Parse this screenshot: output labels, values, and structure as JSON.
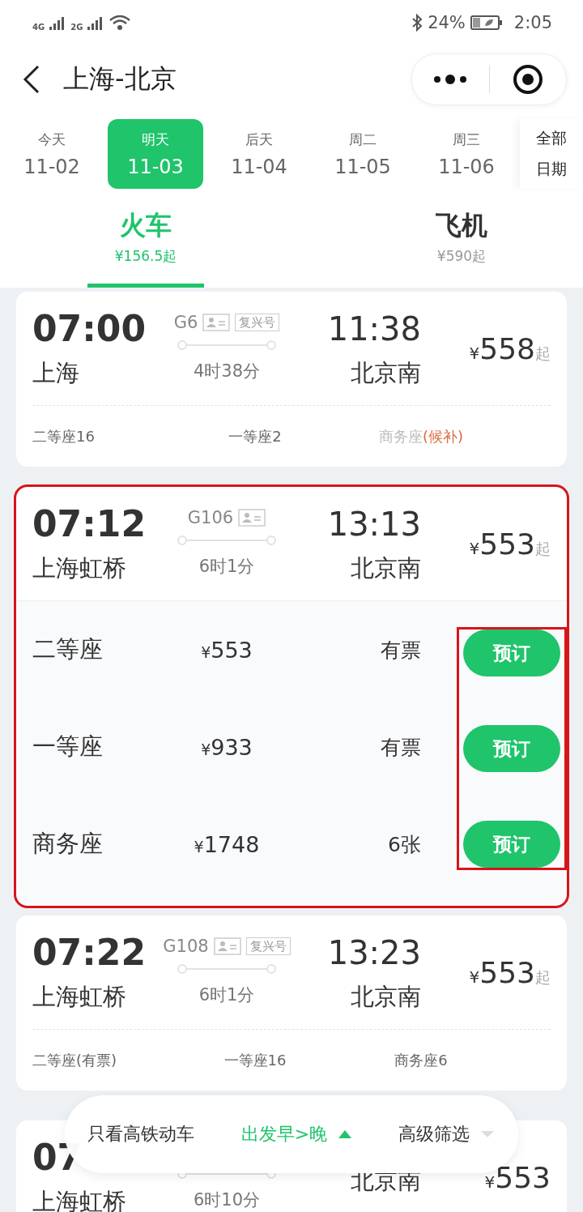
{
  "status_bar": {
    "network_1": "4G",
    "network_2": "2G",
    "battery": "24%",
    "time": "2:05"
  },
  "header": {
    "title": "上海-北京"
  },
  "dates": [
    {
      "weekday": "今天",
      "date": "11-02",
      "selected": false
    },
    {
      "weekday": "明天",
      "date": "11-03",
      "selected": true
    },
    {
      "weekday": "后天",
      "date": "11-04",
      "selected": false
    },
    {
      "weekday": "周二",
      "date": "11-05",
      "selected": false
    },
    {
      "weekday": "周三",
      "date": "11-06",
      "selected": false
    }
  ],
  "all_dates": {
    "line_1": "全部",
    "line_2": "日期"
  },
  "mode_tabs": [
    {
      "label": "火车",
      "price": "¥156.5起",
      "selected": true
    },
    {
      "label": "飞机",
      "price": "¥590起",
      "selected": false
    }
  ],
  "trains": [
    {
      "departure": "07:00",
      "from": "上海",
      "train_no": "G6",
      "type_tag": "复兴号",
      "duration": "4时38分",
      "arrival": "11:38",
      "to": "北京南",
      "currency": "¥",
      "price": "558",
      "suffix": "起",
      "kind": "collapsed",
      "annotated": false,
      "seats": [
        {
          "name": "二等座",
          "status": "16",
          "available": true
        },
        {
          "name": "一等座",
          "status": "2",
          "available": true
        },
        {
          "name": "商务座",
          "status": "(候补)",
          "available": false
        }
      ]
    },
    {
      "departure": "07:12",
      "from": "上海虹桥",
      "train_no": "G106",
      "duration": "6时1分",
      "arrival": "13:13",
      "to": "北京南",
      "currency": "¥",
      "price": "553",
      "suffix": "起",
      "kind": "expanded",
      "annotated": true,
      "seats": [
        {
          "name": "二等座",
          "currency": "¥",
          "price": "553",
          "status": "有票",
          "button": "预订"
        },
        {
          "name": "一等座",
          "currency": "¥",
          "price": "933",
          "status": "有票",
          "button": "预订"
        },
        {
          "name": "商务座",
          "currency": "¥",
          "price": "1748",
          "status": "6张",
          "button": "预订"
        }
      ]
    },
    {
      "departure": "07:22",
      "from": "上海虹桥",
      "train_no": "G108",
      "type_tag": "复兴号",
      "duration": "6时1分",
      "arrival": "13:23",
      "to": "北京南",
      "currency": "¥",
      "price": "553",
      "suffix": "起",
      "kind": "collapsed",
      "annotated": false,
      "seats": [
        {
          "name": "二等座",
          "status": "(有票)",
          "available": true
        },
        {
          "name": "一等座",
          "status": "16",
          "available": true
        },
        {
          "name": "商务座",
          "status": "6",
          "available": true
        }
      ]
    },
    {
      "departure": "07",
      "from": "上海虹桥",
      "duration": "6时10分",
      "to": "北京南",
      "currency": "¥",
      "price": "553",
      "annotated": false
    }
  ],
  "filters": [
    {
      "label": "只看高铁动车",
      "kind": "toggle",
      "selected": false
    },
    {
      "label": "出发早>晚",
      "kind": "sort",
      "selected": true
    },
    {
      "label": "高级筛选",
      "kind": "menu",
      "selected": false
    }
  ]
}
